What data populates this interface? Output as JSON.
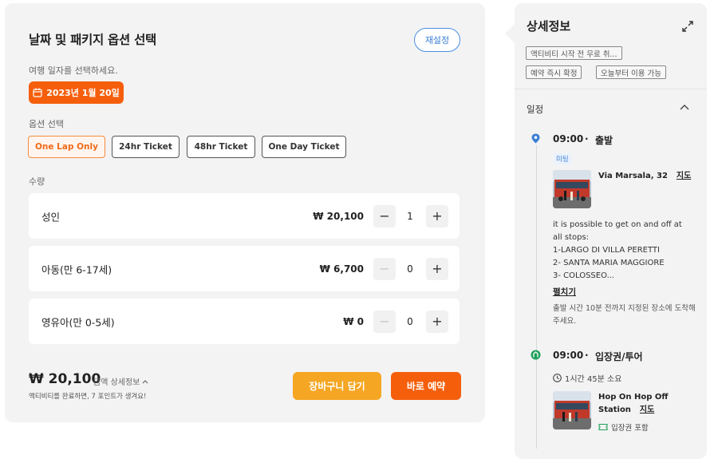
{
  "booking": {
    "title": "날짜 및 패키지 옵션 선택",
    "reset_label": "재설정",
    "date_prompt": "여행 일자를 선택하세요.",
    "selected_date": "2023년 1월 20일",
    "option_label": "옵션 선택",
    "options": [
      {
        "label": "One Lap Only",
        "selected": true
      },
      {
        "label": "24hr Ticket",
        "selected": false
      },
      {
        "label": "48hr Ticket",
        "selected": false
      },
      {
        "label": "One Day Ticket",
        "selected": false
      }
    ],
    "quantity_label": "수량",
    "quantities": [
      {
        "label": "성인",
        "price": "₩ 20,100",
        "count": "1",
        "minus_enabled": true
      },
      {
        "label": "아동(만 6-17세)",
        "price": "₩ 6,700",
        "count": "0",
        "minus_enabled": false
      },
      {
        "label": "영유아(만 0-5세)",
        "price": "₩ 0",
        "count": "0",
        "minus_enabled": false
      }
    ],
    "minus_symbol": "−",
    "plus_symbol": "+",
    "total_price": "₩ 20,100",
    "total_detail": "금액 상세정보",
    "points_note": "액티비티를 완료하면, 7 포인트가 생겨요!",
    "cart_label": "장바구니 담기",
    "book_label": "바로 예약",
    "accent_color": "#f55f0c"
  },
  "details": {
    "title": "상세정보",
    "tags": [
      "액티비티 시작 전 무료 취...",
      "예약 즉시 확정",
      "오늘부터 이용 가능"
    ],
    "schedule_label": "일정",
    "stops": [
      {
        "time": "09:00",
        "dot": "·",
        "title": "출발",
        "badge": "미팅",
        "place": "Via Marsala, 32",
        "map_label": "지도",
        "description_lines": [
          "it is possible to get on and off at",
          "all stops:",
          "1-LARGO DI VILLA PERETTI",
          "2- SANTA MARIA MAGGIORE",
          "3- COLOSSEO..."
        ],
        "expand_label": "펼치기",
        "note": "출발 시간 10분 전까지 지정된 장소에 도착해주세요."
      },
      {
        "time": "09:00",
        "dot": "·",
        "title": "입장권/투어",
        "duration": "1시간 45분 소요",
        "place_line1": "Hop On Hop Off",
        "place_line2": "Station",
        "map_label": "지도",
        "ticket_included": "입장권 포함"
      }
    ]
  }
}
